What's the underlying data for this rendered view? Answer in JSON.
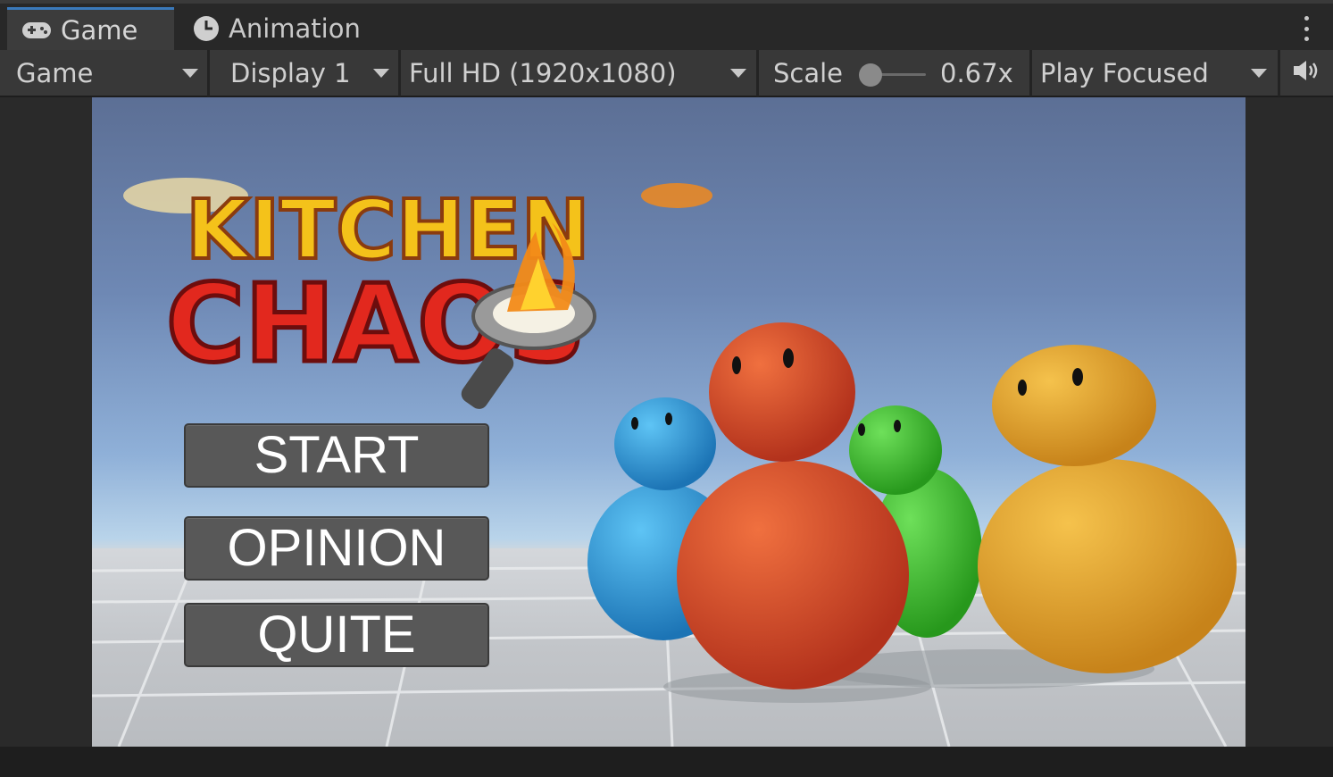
{
  "tabs": [
    {
      "label": "Game",
      "icon": "gamepad-icon",
      "active": true
    },
    {
      "label": "Animation",
      "icon": "clock-icon",
      "active": false
    }
  ],
  "toolbar": {
    "view_mode": "Game",
    "display": "Display 1",
    "resolution": "Full HD (1920x1080)",
    "scale_label": "Scale",
    "scale_value": "0.67x",
    "play_mode": "Play Focused",
    "audio_icon": "speaker-icon"
  },
  "game": {
    "logo_line1": "KITCHEN",
    "logo_line2": "CHAOS",
    "buttons": {
      "start": "START",
      "opinion": "OPINION",
      "quite": "QUITE"
    }
  },
  "colors": {
    "accent": "#3a79bb",
    "character_blue": "#2f97d6",
    "character_red": "#d8492c",
    "character_green": "#3fbf2e",
    "character_yellow": "#e0a22a"
  }
}
